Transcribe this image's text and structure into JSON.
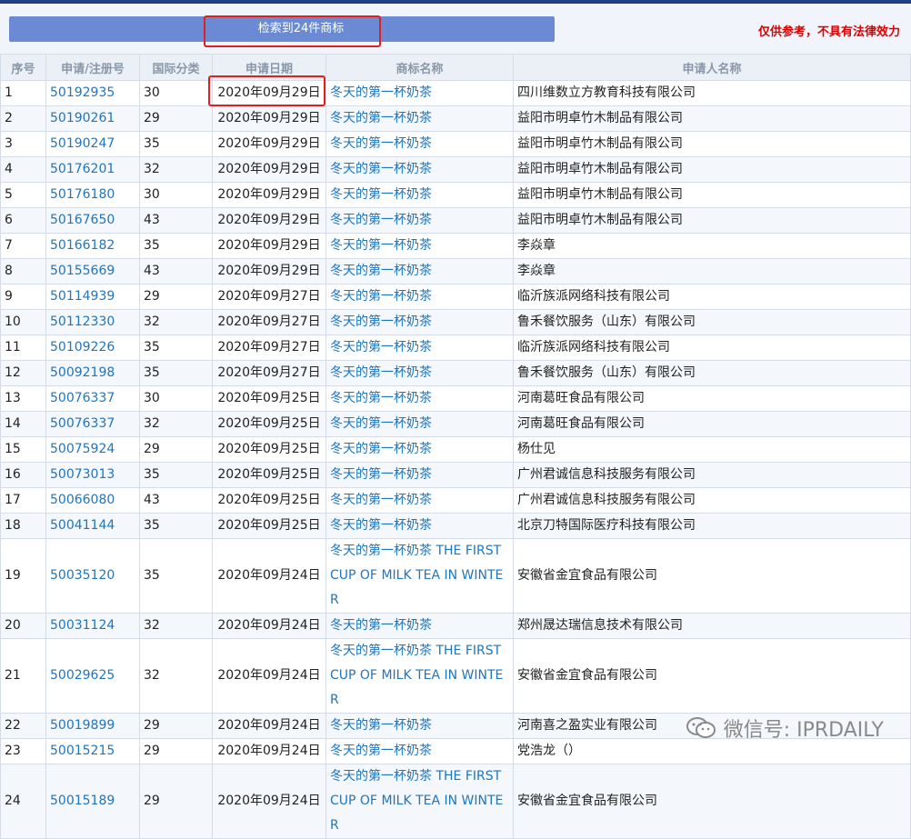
{
  "header": {
    "search_result_label": "检索到24件商标",
    "disclaimer": "仅供参考，不具有法律效力"
  },
  "table": {
    "columns": [
      "序号",
      "申请/注册号",
      "国际分类",
      "申请日期",
      "商标名称",
      "申请人名称"
    ],
    "rows": [
      {
        "no": "1",
        "reg": "50192935",
        "cls": "30",
        "date": "2020年09月29日",
        "mark": "冬天的第一杯奶茶",
        "applicant": "四川维数立方教育科技有限公司"
      },
      {
        "no": "2",
        "reg": "50190261",
        "cls": "29",
        "date": "2020年09月29日",
        "mark": "冬天的第一杯奶茶",
        "applicant": "益阳市明卓竹木制品有限公司"
      },
      {
        "no": "3",
        "reg": "50190247",
        "cls": "35",
        "date": "2020年09月29日",
        "mark": "冬天的第一杯奶茶",
        "applicant": "益阳市明卓竹木制品有限公司"
      },
      {
        "no": "4",
        "reg": "50176201",
        "cls": "32",
        "date": "2020年09月29日",
        "mark": "冬天的第一杯奶茶",
        "applicant": "益阳市明卓竹木制品有限公司"
      },
      {
        "no": "5",
        "reg": "50176180",
        "cls": "30",
        "date": "2020年09月29日",
        "mark": "冬天的第一杯奶茶",
        "applicant": "益阳市明卓竹木制品有限公司"
      },
      {
        "no": "6",
        "reg": "50167650",
        "cls": "43",
        "date": "2020年09月29日",
        "mark": "冬天的第一杯奶茶",
        "applicant": "益阳市明卓竹木制品有限公司"
      },
      {
        "no": "7",
        "reg": "50166182",
        "cls": "35",
        "date": "2020年09月29日",
        "mark": "冬天的第一杯奶茶",
        "applicant": "李焱章"
      },
      {
        "no": "8",
        "reg": "50155669",
        "cls": "43",
        "date": "2020年09月29日",
        "mark": "冬天的第一杯奶茶",
        "applicant": "李焱章"
      },
      {
        "no": "9",
        "reg": "50114939",
        "cls": "29",
        "date": "2020年09月27日",
        "mark": "冬天的第一杯奶茶",
        "applicant": "临沂族派网络科技有限公司"
      },
      {
        "no": "10",
        "reg": "50112330",
        "cls": "32",
        "date": "2020年09月27日",
        "mark": "冬天的第一杯奶茶",
        "applicant": "鲁禾餐饮服务（山东）有限公司"
      },
      {
        "no": "11",
        "reg": "50109226",
        "cls": "35",
        "date": "2020年09月27日",
        "mark": "冬天的第一杯奶茶",
        "applicant": "临沂族派网络科技有限公司"
      },
      {
        "no": "12",
        "reg": "50092198",
        "cls": "35",
        "date": "2020年09月27日",
        "mark": "冬天的第一杯奶茶",
        "applicant": "鲁禾餐饮服务（山东）有限公司"
      },
      {
        "no": "13",
        "reg": "50076337",
        "cls": "30",
        "date": "2020年09月25日",
        "mark": "冬天的第一杯奶茶",
        "applicant": "河南葛旺食品有限公司"
      },
      {
        "no": "14",
        "reg": "50076337",
        "cls": "32",
        "date": "2020年09月25日",
        "mark": "冬天的第一杯奶茶",
        "applicant": "河南葛旺食品有限公司"
      },
      {
        "no": "15",
        "reg": "50075924",
        "cls": "29",
        "date": "2020年09月25日",
        "mark": "冬天的第一杯奶茶",
        "applicant": "杨仕见"
      },
      {
        "no": "16",
        "reg": "50073013",
        "cls": "35",
        "date": "2020年09月25日",
        "mark": "冬天的第一杯奶茶",
        "applicant": "广州君诚信息科技服务有限公司"
      },
      {
        "no": "17",
        "reg": "50066080",
        "cls": "43",
        "date": "2020年09月25日",
        "mark": "冬天的第一杯奶茶",
        "applicant": "广州君诚信息科技服务有限公司"
      },
      {
        "no": "18",
        "reg": "50041144",
        "cls": "35",
        "date": "2020年09月25日",
        "mark": "冬天的第一杯奶茶",
        "applicant": "北京刀特国际医疗科技有限公司"
      },
      {
        "no": "19",
        "reg": "50035120",
        "cls": "35",
        "date": "2020年09月24日",
        "mark": "冬天的第一杯奶茶 THE FIRST CUP OF MILK TEA IN WINTER",
        "applicant": "安徽省金宜食品有限公司"
      },
      {
        "no": "20",
        "reg": "50031124",
        "cls": "32",
        "date": "2020年09月24日",
        "mark": "冬天的第一杯奶茶",
        "applicant": "郑州晟达瑞信息技术有限公司"
      },
      {
        "no": "21",
        "reg": "50029625",
        "cls": "32",
        "date": "2020年09月24日",
        "mark": "冬天的第一杯奶茶 THE FIRST CUP OF MILK TEA IN WINTER",
        "applicant": "安徽省金宜食品有限公司"
      },
      {
        "no": "22",
        "reg": "50019899",
        "cls": "29",
        "date": "2020年09月24日",
        "mark": "冬天的第一杯奶茶",
        "applicant": "河南喜之盈实业有限公司"
      },
      {
        "no": "23",
        "reg": "50015215",
        "cls": "29",
        "date": "2020年09月24日",
        "mark": "冬天的第一杯奶茶",
        "applicant": "党浩龙（）"
      },
      {
        "no": "24",
        "reg": "50015189",
        "cls": "29",
        "date": "2020年09月24日",
        "mark": "冬天的第一杯奶茶 THE FIRST CUP OF MILK TEA IN WINTER",
        "applicant": "安徽省金宜食品有限公司"
      }
    ]
  },
  "watermark": {
    "icon": "wechat-icon",
    "text": "微信号: IPRDAILY"
  },
  "colors": {
    "banner": "#6a8bd4",
    "link": "#2175bb",
    "disclaimer": "#d90000",
    "highlight": "#e0201f"
  }
}
